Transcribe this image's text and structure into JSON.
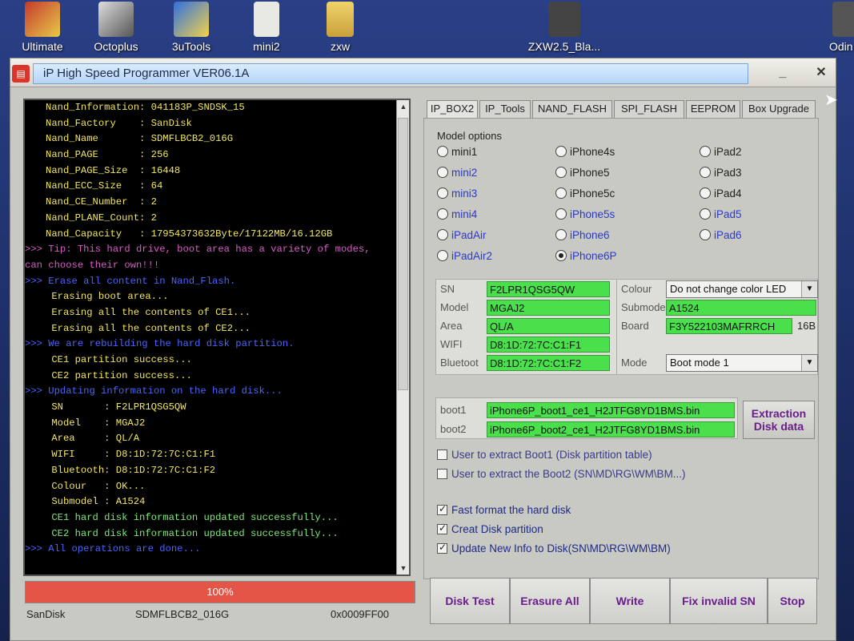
{
  "desktop": {
    "icons": [
      {
        "label": "Ultimate",
        "name": "ultimate-app-icon"
      },
      {
        "label": "Octoplus",
        "name": "octoplus-app-icon"
      },
      {
        "label": "3uTools",
        "name": "3utools-app-icon"
      },
      {
        "label": "mini2",
        "name": "mini2-file-icon"
      },
      {
        "label": "zxw",
        "name": "zxw-folder-icon"
      },
      {
        "label": "ZXW2.5_Bla...",
        "name": "zxw-app-icon"
      },
      {
        "label": "Odin",
        "name": "odin-app-icon"
      }
    ]
  },
  "window": {
    "title": "iP High Speed Programmer VER06.1A",
    "minimize": "_",
    "close": "✕"
  },
  "console": {
    "lines": [
      {
        "text": "Nand_Information: 041183P_SNDSK_15",
        "color": "yellow",
        "type": "kv"
      },
      {
        "text": "Nand_Factory    : SanDisk",
        "color": "yellow",
        "type": "kv"
      },
      {
        "text": "Nand_Name       : SDMFLBCB2_016G",
        "color": "yellow",
        "type": "kv"
      },
      {
        "text": "Nand_PAGE       : 256",
        "color": "yellow",
        "type": "kv"
      },
      {
        "text": "Nand_PAGE_Size  : 16448",
        "color": "yellow",
        "type": "kv"
      },
      {
        "text": "Nand_ECC_Size   : 64",
        "color": "yellow",
        "type": "kv"
      },
      {
        "text": "Nand_CE_Number  : 2",
        "color": "yellow",
        "type": "kv"
      },
      {
        "text": "Nand_PLANE_Count: 2",
        "color": "yellow",
        "type": "kv"
      },
      {
        "text": "Nand_Capacity   : 17954373632Byte/17122MB/16.12GB",
        "color": "yellow",
        "type": "kv"
      },
      {
        "text": ">>> Tip: This hard drive, boot area has a variety of modes,",
        "color": "magenta",
        "type": "tip"
      },
      {
        "text": "can choose their own!!!",
        "color": "magenta",
        "type": "tip"
      },
      {
        "text": ">>> Erase all content in Nand_Flash.",
        "color": "blue",
        "type": "tip"
      },
      {
        "text": " Erasing boot area...",
        "color": "yellow",
        "type": "kv"
      },
      {
        "text": " Erasing all the contents of CE1...",
        "color": "yellow",
        "type": "kv"
      },
      {
        "text": " Erasing all the contents of CE2...",
        "color": "yellow",
        "type": "kv"
      },
      {
        "text": ">>> We are rebuilding the hard disk partition.",
        "color": "blue",
        "type": "tip"
      },
      {
        "text": " CE1 partition success...",
        "color": "yellow",
        "type": "kv"
      },
      {
        "text": " CE2 partition success...",
        "color": "yellow",
        "type": "kv"
      },
      {
        "text": ">>> Updating information on the hard disk...",
        "color": "blue",
        "type": "tip"
      },
      {
        "text": " SN       : F2LPR1QSG5QW",
        "color": "yellow",
        "type": "kv"
      },
      {
        "text": " Model    : MGAJ2",
        "color": "yellow",
        "type": "kv"
      },
      {
        "text": " Area     : QL/A",
        "color": "yellow",
        "type": "kv"
      },
      {
        "text": " WIFI     : D8:1D:72:7C:C1:F1",
        "color": "yellow",
        "type": "kv"
      },
      {
        "text": " Bluetooth: D8:1D:72:7C:C1:F2",
        "color": "yellow",
        "type": "kv"
      },
      {
        "text": " Colour   : OK...",
        "color": "yellow",
        "type": "kv"
      },
      {
        "text": " Submodel : A1524",
        "color": "yellow",
        "type": "kv"
      },
      {
        "text": " CE1 hard disk information updated successfully...",
        "color": "green",
        "type": "kv"
      },
      {
        "text": " CE2 hard disk information updated successfully...",
        "color": "green",
        "type": "kv"
      },
      {
        "text": ">>> All operations are done...",
        "color": "blue",
        "type": "tip"
      }
    ]
  },
  "progress": {
    "label": "100%",
    "value": 1.0
  },
  "status": {
    "vendor": "SanDisk",
    "chip": "SDMFLBCB2_016G",
    "address": "0x0009FF00"
  },
  "tabs": [
    {
      "label": "IP_BOX2",
      "active": true
    },
    {
      "label": "IP_Tools",
      "active": false
    },
    {
      "label": "NAND_FLASH",
      "active": false
    },
    {
      "label": "SPI_FLASH",
      "active": false
    },
    {
      "label": "EEPROM",
      "active": false
    },
    {
      "label": "Box Upgrade",
      "active": false
    }
  ],
  "model_options": {
    "label": "Model options",
    "radios": [
      {
        "label": "mini1",
        "selected": false,
        "blue": false
      },
      {
        "label": "mini2",
        "selected": false,
        "blue": true
      },
      {
        "label": "mini3",
        "selected": false,
        "blue": true
      },
      {
        "label": "mini4",
        "selected": false,
        "blue": true
      },
      {
        "label": "iPadAir",
        "selected": false,
        "blue": true
      },
      {
        "label": "iPadAir2",
        "selected": false,
        "blue": true
      },
      {
        "label": "iPhone4s",
        "selected": false,
        "blue": false
      },
      {
        "label": "iPhone5",
        "selected": false,
        "blue": false
      },
      {
        "label": "iPhone5c",
        "selected": false,
        "blue": false
      },
      {
        "label": "iPhone5s",
        "selected": false,
        "blue": true
      },
      {
        "label": "iPhone6",
        "selected": false,
        "blue": true
      },
      {
        "label": "iPhone6P",
        "selected": true,
        "blue": true
      },
      {
        "label": "iPad2",
        "selected": false,
        "blue": false
      },
      {
        "label": "iPad3",
        "selected": false,
        "blue": false
      },
      {
        "label": "iPad4",
        "selected": false,
        "blue": false
      },
      {
        "label": "iPad5",
        "selected": false,
        "blue": true
      },
      {
        "label": "iPad6",
        "selected": false,
        "blue": true
      }
    ]
  },
  "info": {
    "sn": {
      "label": "SN",
      "value": "F2LPR1QSG5QW"
    },
    "model": {
      "label": "Model",
      "value": "MGAJ2"
    },
    "area": {
      "label": "Area",
      "value": "QL/A"
    },
    "wifi": {
      "label": "WIFI",
      "value": "D8:1D:72:7C:C1:F1"
    },
    "bluetooth": {
      "label": "Bluetoot",
      "value": "D8:1D:72:7C:C1:F2"
    },
    "colour": {
      "label": "Colour",
      "value": "Do not change color LED"
    },
    "submodel": {
      "label": "Submode",
      "value": "A1524"
    },
    "board": {
      "label": "Board",
      "value": "F3Y522103MAFRRCH",
      "suffix": "16B"
    },
    "mode": {
      "label": "Mode",
      "value": "Boot mode 1"
    }
  },
  "boot": {
    "boot1": {
      "label": "boot1",
      "value": "iPhone6P_boot1_ce1_H2JTFG8YD1BMS.bin"
    },
    "boot2": {
      "label": "boot2",
      "value": "iPhone6P_boot2_ce1_H2JTFG8YD1BMS.bin"
    },
    "extract_button_line1": "Extraction",
    "extract_button_line2": "Disk data"
  },
  "checkboxes": [
    {
      "label": "User to extract Boot1 (Disk partition table)",
      "checked": false
    },
    {
      "label": "User to extract the Boot2 (SN\\MD\\RG\\WM\\BM...)",
      "checked": false
    },
    {
      "label": "Fast format the hard disk",
      "checked": true
    },
    {
      "label": "Creat Disk partition",
      "checked": true
    },
    {
      "label": "Update New Info to Disk(SN\\MD\\RG\\WM\\BM)",
      "checked": true
    }
  ],
  "actions": {
    "disk_test": "Disk Test",
    "erasure_all": "Erasure All",
    "write": "Write",
    "fix_invalid_sn": "Fix invalid SN",
    "stop": "Stop"
  }
}
